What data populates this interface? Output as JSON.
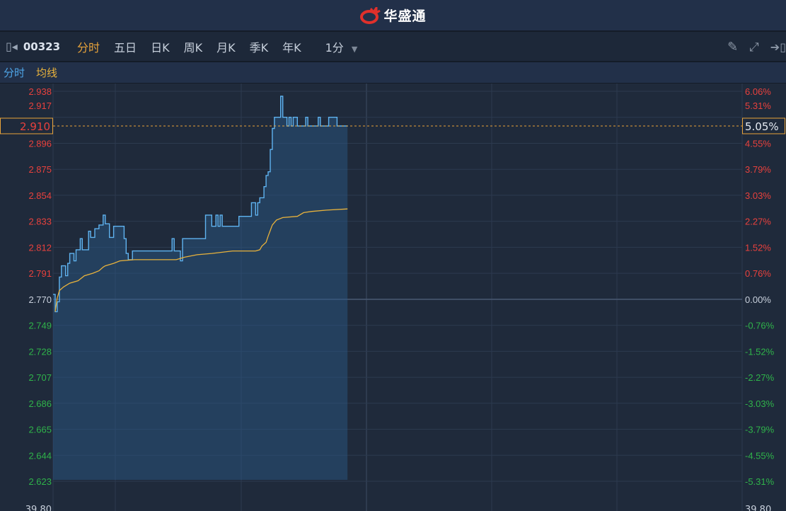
{
  "app": {
    "title": "华盛通"
  },
  "toolbar": {
    "stock_code": "00323",
    "tabs": [
      {
        "label": "分时",
        "active": true
      },
      {
        "label": "五日"
      },
      {
        "label": "日K"
      },
      {
        "label": "周K"
      },
      {
        "label": "月K"
      },
      {
        "label": "季K"
      },
      {
        "label": "年K"
      }
    ],
    "interval": "1分",
    "icons": [
      "collapse-panel-icon",
      "pencil-icon",
      "fullscreen-icon",
      "exit-icon"
    ]
  },
  "legend": {
    "price_label": "分时",
    "avg_label": "均线"
  },
  "colors": {
    "up": "#e8413d",
    "down": "#2fb34a",
    "price": "#5fb3f0",
    "avg": "#e8b23c",
    "accent": "#e8a33a"
  },
  "chart_data": {
    "type": "line",
    "x_unit": "minutes since open",
    "xlim": [
      0,
      330
    ],
    "ylim": [
      2.623,
      2.938
    ],
    "prev_close": 2.77,
    "current_price": "2.910",
    "current_change": "5.05%",
    "left_ticks": [
      "2.938",
      "2.917",
      "2.896",
      "2.875",
      "2.854",
      "2.833",
      "2.812",
      "2.791",
      "2.770",
      "2.749",
      "2.728",
      "2.707",
      "2.686",
      "2.665",
      "2.644",
      "2.623"
    ],
    "right_ticks": [
      "6.06%",
      "5.31%",
      "4.55%",
      "3.79%",
      "3.03%",
      "2.27%",
      "1.52%",
      "0.76%",
      "0.00%",
      "-0.76%",
      "-1.52%",
      "-2.27%",
      "-3.03%",
      "-3.79%",
      "-4.55%",
      "-5.31%"
    ],
    "volume_label_left": "39.80",
    "volume_label_right": "39.80",
    "series": [
      {
        "name": "分时",
        "points": [
          [
            0,
            2.774
          ],
          [
            1,
            2.76
          ],
          [
            2,
            2.768
          ],
          [
            3,
            2.788
          ],
          [
            4,
            2.797
          ],
          [
            6,
            2.789
          ],
          [
            7,
            2.799
          ],
          [
            8,
            2.807
          ],
          [
            10,
            2.801
          ],
          [
            11,
            2.81
          ],
          [
            13,
            2.819
          ],
          [
            14,
            2.81
          ],
          [
            15,
            2.81
          ],
          [
            17,
            2.825
          ],
          [
            18,
            2.82
          ],
          [
            20,
            2.827
          ],
          [
            22,
            2.83
          ],
          [
            24,
            2.838
          ],
          [
            25,
            2.831
          ],
          [
            27,
            2.82
          ],
          [
            29,
            2.829
          ],
          [
            32,
            2.829
          ],
          [
            34,
            2.819
          ],
          [
            35,
            2.807
          ],
          [
            36,
            2.802
          ],
          [
            38,
            2.809
          ],
          [
            56,
            2.809
          ],
          [
            57,
            2.819
          ],
          [
            58,
            2.809
          ],
          [
            60,
            2.809
          ],
          [
            61,
            2.801
          ],
          [
            62,
            2.819
          ],
          [
            71,
            2.819
          ],
          [
            73,
            2.838
          ],
          [
            75,
            2.838
          ],
          [
            76,
            2.829
          ],
          [
            78,
            2.838
          ],
          [
            79,
            2.829
          ],
          [
            80,
            2.838
          ],
          [
            81,
            2.829
          ],
          [
            88,
            2.829
          ],
          [
            89,
            2.837
          ],
          [
            93,
            2.837
          ],
          [
            95,
            2.848
          ],
          [
            96,
            2.848
          ],
          [
            97,
            2.838
          ],
          [
            98,
            2.848
          ],
          [
            99,
            2.852
          ],
          [
            101,
            2.861
          ],
          [
            102,
            2.87
          ],
          [
            103,
            2.873
          ],
          [
            104,
            2.891
          ],
          [
            105,
            2.908
          ],
          [
            106,
            2.917
          ],
          [
            108,
            2.917
          ],
          [
            109,
            2.934
          ],
          [
            110,
            2.917
          ],
          [
            111,
            2.917
          ],
          [
            112,
            2.91
          ],
          [
            113,
            2.917
          ],
          [
            114,
            2.91
          ],
          [
            115,
            2.917
          ],
          [
            116,
            2.917
          ],
          [
            117,
            2.91
          ],
          [
            120,
            2.91
          ],
          [
            121,
            2.917
          ],
          [
            122,
            2.91
          ],
          [
            126,
            2.91
          ],
          [
            127,
            2.917
          ],
          [
            128,
            2.91
          ],
          [
            131,
            2.91
          ],
          [
            132,
            2.917
          ],
          [
            135,
            2.917
          ],
          [
            136,
            2.91
          ],
          [
            141,
            2.91
          ]
        ]
      },
      {
        "name": "均线",
        "points": [
          [
            1,
            2.76
          ],
          [
            2,
            2.771
          ],
          [
            3,
            2.777
          ],
          [
            5,
            2.78
          ],
          [
            8,
            2.783
          ],
          [
            12,
            2.785
          ],
          [
            15,
            2.789
          ],
          [
            19,
            2.791
          ],
          [
            22,
            2.793
          ],
          [
            24,
            2.796
          ],
          [
            25,
            2.797
          ],
          [
            29,
            2.799
          ],
          [
            32,
            2.801
          ],
          [
            39,
            2.802
          ],
          [
            59,
            2.802
          ],
          [
            63,
            2.804
          ],
          [
            69,
            2.806
          ],
          [
            76,
            2.807
          ],
          [
            86,
            2.809
          ],
          [
            97,
            2.809
          ],
          [
            99,
            2.81
          ],
          [
            100,
            2.813
          ],
          [
            102,
            2.816
          ],
          [
            103,
            2.821
          ],
          [
            105,
            2.83
          ],
          [
            107,
            2.834
          ],
          [
            110,
            2.836
          ],
          [
            117,
            2.837
          ],
          [
            120,
            2.84
          ],
          [
            124,
            2.841
          ],
          [
            131,
            2.842
          ],
          [
            141,
            2.843
          ]
        ]
      }
    ]
  }
}
